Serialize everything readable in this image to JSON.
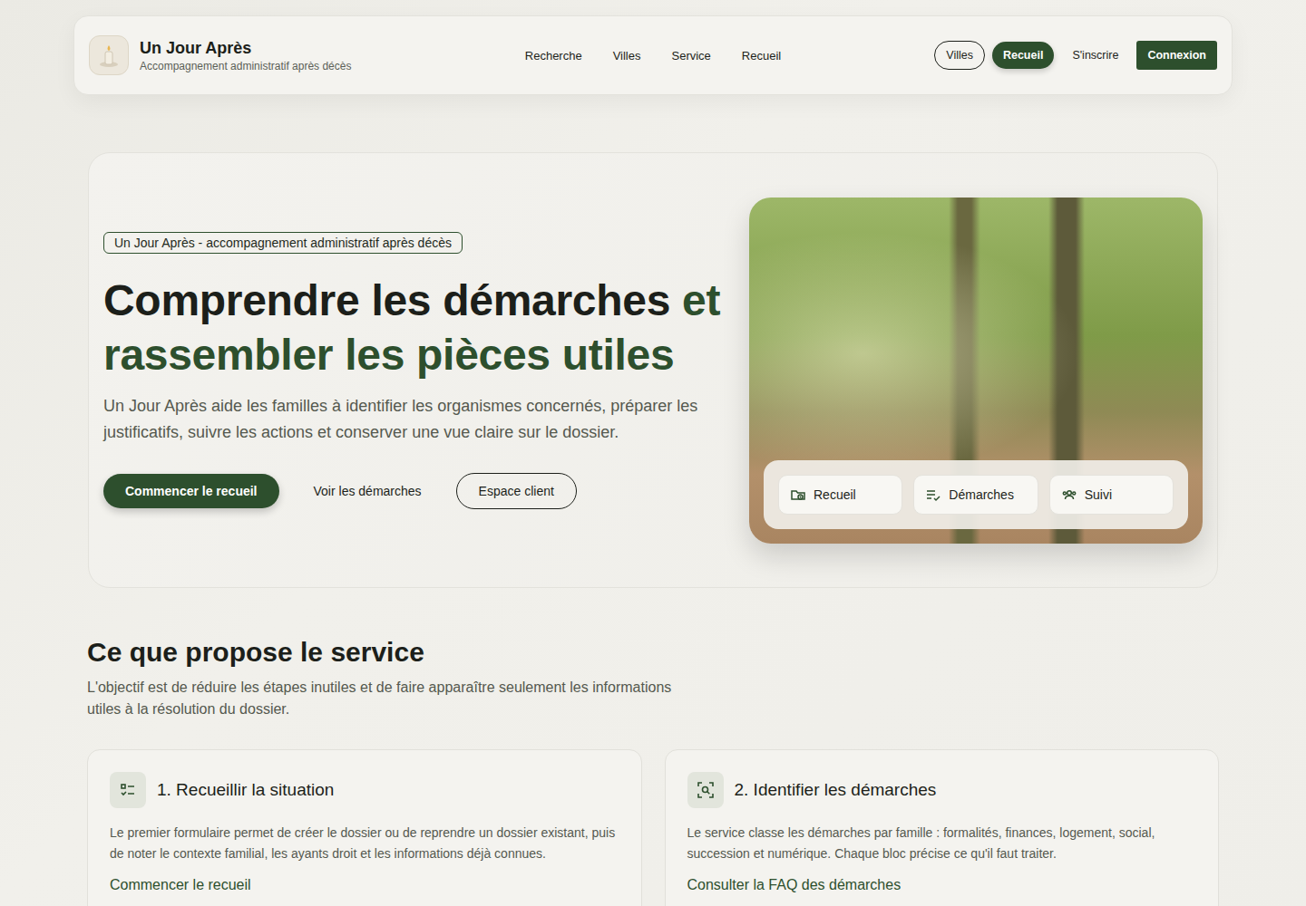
{
  "header": {
    "brand": {
      "title": "Un Jour Après",
      "subtitle": "Accompagnement administratif après décès"
    },
    "nav": [
      "Recherche",
      "Villes",
      "Service",
      "Recueil"
    ],
    "actions": [
      {
        "label": "Villes",
        "kind": "outline"
      },
      {
        "label": "Recueil",
        "kind": "filled"
      },
      {
        "label": "S'inscrire",
        "kind": "text"
      },
      {
        "label": "Connexion",
        "kind": "primary"
      }
    ]
  },
  "hero": {
    "badge": "Un Jour Après - accompagnement administratif après décès",
    "title_dark": "Comprendre les démarches",
    "title_green": "et rassembler les pièces utiles",
    "text": "Un Jour Après aide les familles à identifier les organismes concernés, préparer les justificatifs, suivre les actions et conserver une vue claire sur le dossier.",
    "buttons": [
      {
        "label": "Commencer le recueil",
        "kind": "filled"
      },
      {
        "label": "Voir les démarches",
        "kind": "text"
      },
      {
        "label": "Espace client",
        "kind": "outline"
      }
    ],
    "chips": [
      "Recueil",
      "Démarches",
      "Suivi"
    ]
  },
  "service": {
    "title": "Ce que propose le service",
    "text": "L'objectif est de réduire les étapes inutiles et de faire apparaître seulement les informations utiles à la résolution du dossier.",
    "cards": [
      {
        "title": "1. Recueillir la situation",
        "text": "Le premier formulaire permet de créer le dossier ou de reprendre un dossier existant, puis de noter le contexte familial, les ayants droit et les informations déjà connues.",
        "link": "Commencer le recueil"
      },
      {
        "title": "2. Identifier les démarches",
        "text": "Le service classe les démarches par famille : formalités, finances, logement, social, succession et numérique. Chaque bloc précise ce qu'il faut traiter.",
        "link": "Consulter la FAQ des démarches"
      }
    ]
  }
}
